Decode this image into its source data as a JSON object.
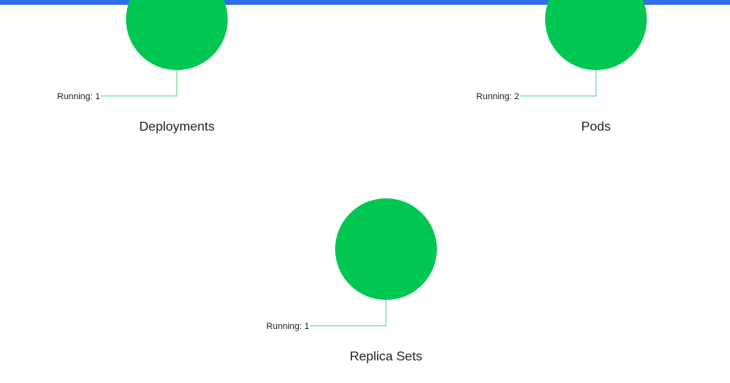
{
  "accent_color": "#326de6",
  "status_color": "#00c752",
  "charts": [
    {
      "title": "Deployments",
      "chart_data": {
        "type": "pie",
        "title": "Deployments",
        "slices": [
          {
            "label": "Running",
            "value": 1
          }
        ],
        "annotations": [
          "Running: 1"
        ]
      }
    },
    {
      "title": "Pods",
      "chart_data": {
        "type": "pie",
        "title": "Pods",
        "slices": [
          {
            "label": "Running",
            "value": 2
          }
        ],
        "annotations": [
          "Running: 2"
        ]
      }
    },
    {
      "title": "Replica Sets",
      "chart_data": {
        "type": "pie",
        "title": "Replica Sets",
        "slices": [
          {
            "label": "Running",
            "value": 1
          }
        ],
        "annotations": [
          "Running: 1"
        ]
      }
    }
  ]
}
